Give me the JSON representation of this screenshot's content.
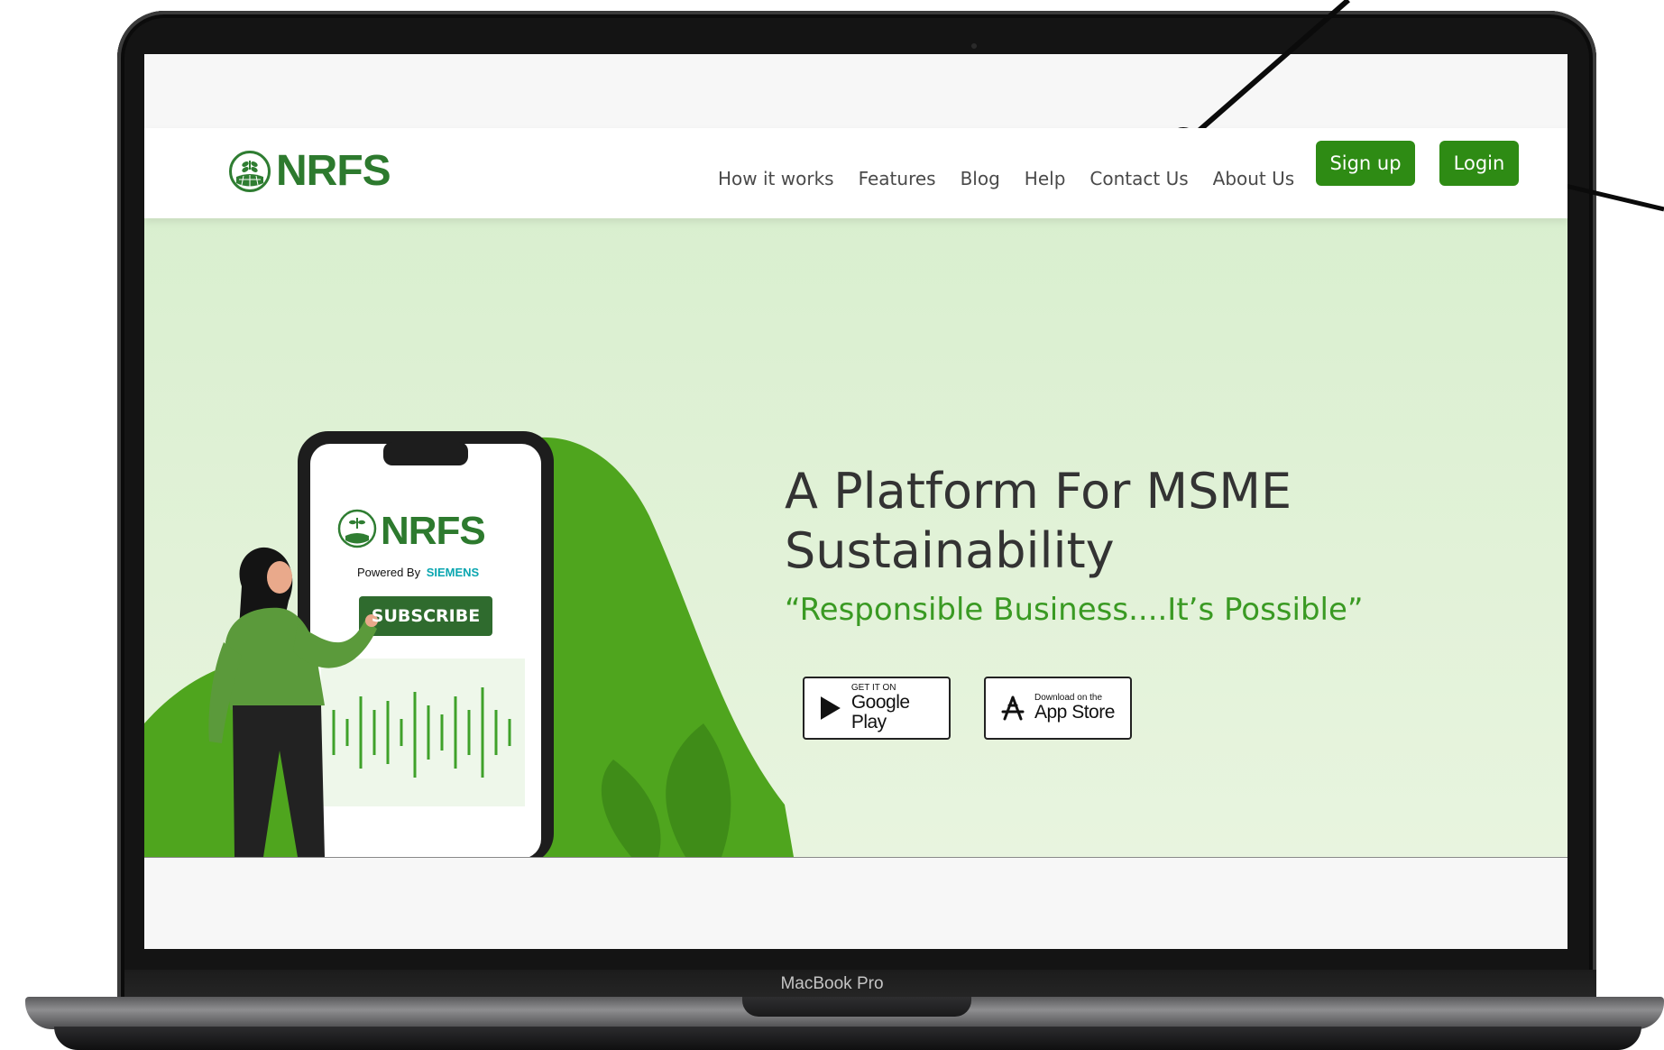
{
  "device": {
    "label": "MacBook Pro"
  },
  "site": {
    "logo_text": "NRFS",
    "nav": {
      "links": [
        "How it works",
        "Features",
        "Blog",
        "Help",
        "Contact Us",
        "About Us"
      ],
      "signup_label": "Sign up",
      "login_label": "Login"
    },
    "hero": {
      "headline_line1": "A Platform For MSME",
      "headline_line2": "Sustainability",
      "tagline": "“Responsible Business....It’s Possible”",
      "phone": {
        "logo_text": "NRFS",
        "powered_by": "Powered By",
        "brand": "SIEMENS",
        "subscribe_label": "SUBSCRIBE"
      },
      "store_buttons": [
        {
          "small": "GET IT ON",
          "big": "Google Play"
        },
        {
          "small": "Download on the",
          "big": "App Store"
        }
      ]
    }
  },
  "colors": {
    "brand_green": "#2e8b14",
    "logo_green": "#2d7a2e",
    "tagline_green": "#3a9a23",
    "hero_bg": "#dcefd2",
    "annotation_dot": "#0f7a3e"
  }
}
